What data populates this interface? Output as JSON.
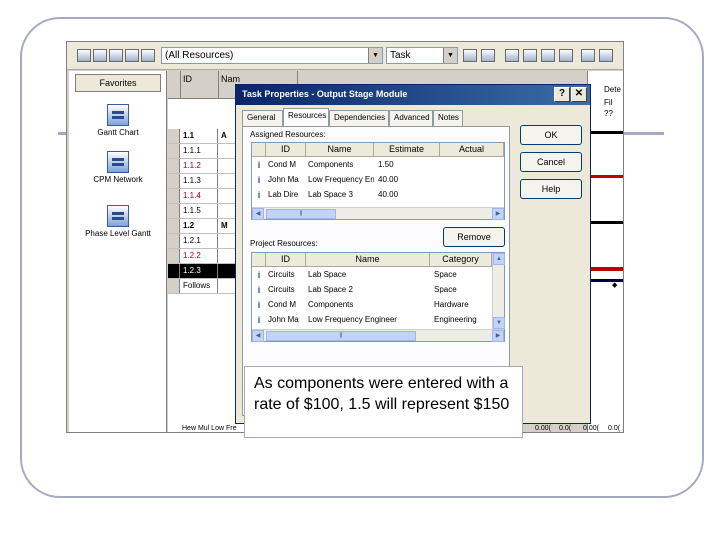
{
  "toolbar": {
    "resource_filter": "(All Resources)",
    "task_filter": "Task"
  },
  "views_bar": {
    "favorites": "Favorites",
    "items": [
      {
        "label": "Gantt Chart"
      },
      {
        "label": "CPM Network"
      },
      {
        "label": "Phase Level Gantt"
      }
    ]
  },
  "grid": {
    "col_id": "ID",
    "col_name": "Nam",
    "rows": [
      {
        "id": "1.1",
        "name": "A"
      },
      {
        "id": "1.1.1",
        "name": ""
      },
      {
        "id": "1.1.2",
        "name": ""
      },
      {
        "id": "1.1.3",
        "name": ""
      },
      {
        "id": "1.1.4",
        "name": ""
      },
      {
        "id": "1.1.5",
        "name": ""
      },
      {
        "id": "1.2",
        "name": "M"
      },
      {
        "id": "1.2.1",
        "name": ""
      },
      {
        "id": "1.2.2",
        "name": ""
      },
      {
        "id": "1.2.3",
        "name": ""
      },
      {
        "id": "Follows",
        "name": ""
      }
    ],
    "right_header": [
      "Dete",
      "Fil",
      "??"
    ],
    "bottom_row": [
      "Hew Mul Low Fre",
      "0.00(",
      "0.0(",
      "0.00(",
      "0.0("
    ]
  },
  "dialog": {
    "title": "Task Properties - Output Stage Module",
    "tabs": [
      "General",
      "Resources",
      "Dependencies",
      "Advanced",
      "Notes"
    ],
    "active_tab": "Resources",
    "assigned_label": "Assigned Resources:",
    "assigned_columns": [
      "ID",
      "Name",
      "Estimate",
      "Actual"
    ],
    "assigned_rows": [
      {
        "id": "Cond M",
        "name": "Components",
        "estimate": "1.50",
        "actual": ""
      },
      {
        "id": "John Ma",
        "name": "Low Frequency Engi",
        "estimate": "40.00",
        "actual": ""
      },
      {
        "id": "Lab Dire",
        "name": "Lab Space 3",
        "estimate": "40.00",
        "actual": ""
      }
    ],
    "remove_button": "Remove",
    "project_label": "Project Resources:",
    "project_columns": [
      "ID",
      "Name",
      "Category"
    ],
    "project_rows": [
      {
        "id": "Circuits",
        "name": "Lab Space",
        "category": "Space"
      },
      {
        "id": "Circuits",
        "name": "Lab Space 2",
        "category": "Space"
      },
      {
        "id": "Cond M",
        "name": "Components",
        "category": "Hardware"
      },
      {
        "id": "John Ma",
        "name": "Low Frequency Engineer",
        "category": "Engineering"
      }
    ],
    "ok_button": "OK",
    "cancel_button": "Cancel",
    "help_button": "Help"
  },
  "caption": "As components were entered with a rate of $100, 1.5 will represent $150"
}
